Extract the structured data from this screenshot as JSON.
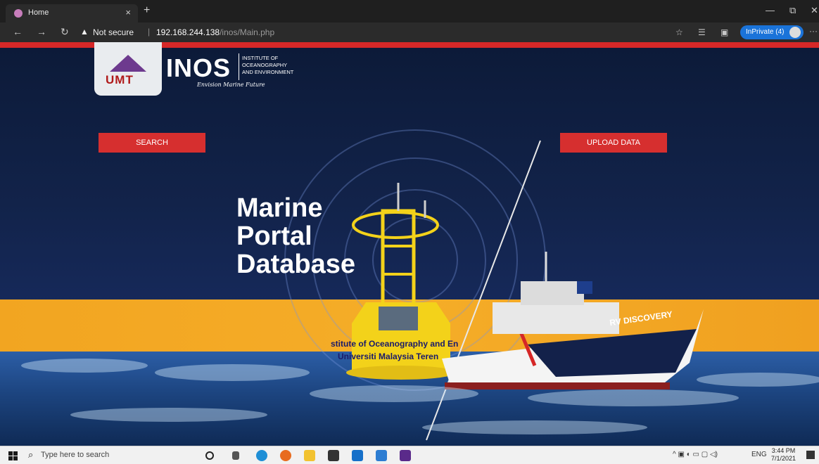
{
  "browser": {
    "tab_title": "Home",
    "tab_close": "×",
    "new_tab": "+",
    "window_minimize": "—",
    "window_restore": "⧉",
    "window_close": "✕",
    "nav_back": "←",
    "nav_forward": "→",
    "nav_refresh": "↻",
    "warning_glyph": "▲",
    "security_label": "Not secure",
    "separator": "|",
    "url_host": "192.168.244.138",
    "url_path": "/inos/Main.php",
    "favorite_glyph": "☆",
    "favorites_glyph": "☰",
    "collections_glyph": "▣",
    "inprivate_label": "InPrivate (4)",
    "more_glyph": "···"
  },
  "page": {
    "logo": {
      "umt": "UMT",
      "inos": "INOS",
      "inos_sub": [
        "INSTITUTE OF",
        "OCEANOGRAPHY",
        "AND ENVIRONMENT"
      ],
      "slogan": "Envision Marine Future"
    },
    "search_button": "SEARCH",
    "upload_button": "UPLOAD DATA",
    "headline": [
      "Marine",
      "Portal",
      "Database"
    ],
    "buoy_text": [
      "stitute of Oceanography and En",
      "Universiti Malaysia Teren"
    ],
    "ship_name": "RV DISCOVERY"
  },
  "taskbar": {
    "search_glyph": "⌕",
    "search_placeholder": "Type here to search",
    "tray_icons": "^ ▣ ◐ ▭ ▢ ◁)",
    "language": "ENG",
    "time": "3:44 PM",
    "date": "7/1/2021"
  },
  "colors": {
    "brand_red": "#d62f2f",
    "navy": "#12234a",
    "orange": "#f2a521",
    "buoy_yellow": "#f3d21a"
  }
}
